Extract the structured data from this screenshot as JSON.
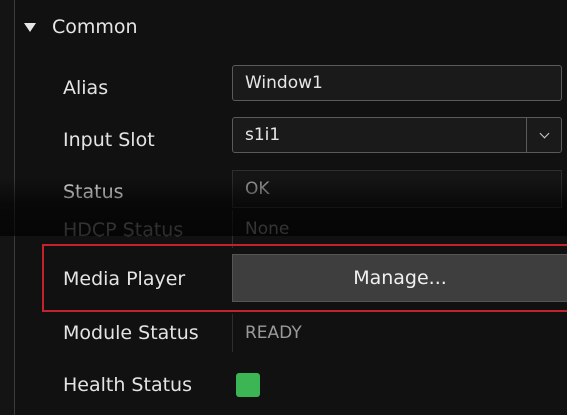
{
  "section": {
    "title": "Common"
  },
  "fields": {
    "alias": {
      "label": "Alias",
      "value": "Window1"
    },
    "input_slot": {
      "label": "Input Slot",
      "value": "s1i1"
    },
    "status": {
      "label": "Status",
      "value": "OK"
    },
    "hdcp_status": {
      "label": "HDCP Status",
      "value": "None"
    },
    "media_player": {
      "label": "Media Player",
      "button_label": "Manage..."
    },
    "module_status": {
      "label": "Module Status",
      "value": "READY"
    },
    "health_status": {
      "label": "Health Status",
      "color": "#3cb554"
    }
  },
  "colors": {
    "highlight_border": "#c4232d",
    "panel_background": "#111111"
  },
  "icons": {
    "section_toggle": "caret-down-icon",
    "select_arrow": "chevron-down-icon"
  }
}
